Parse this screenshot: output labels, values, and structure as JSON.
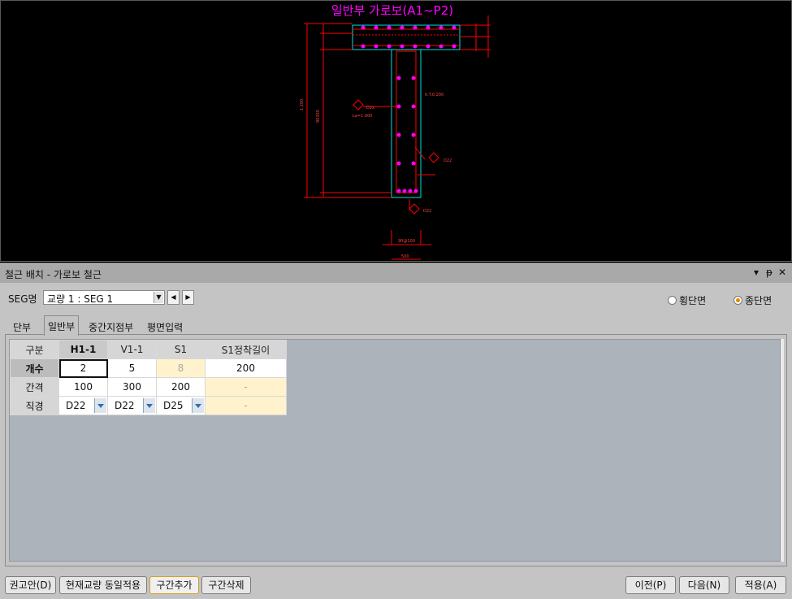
{
  "drawing": {
    "title": "일반부 가로보(A1~P2)",
    "dims": {
      "height_total": "1 200",
      "height_web": "90300",
      "web_note": "0.T.0.200",
      "callout_left": "D2x",
      "callout_left_sub": "La=1.000",
      "callout_right": "D22",
      "callout_bottom": "D22",
      "bottom_dim": "90@100",
      "bottom_total": "500"
    },
    "colors": {
      "background": "#000000",
      "dim": "#ff0000",
      "section": "#00e0e0",
      "rebar": "#ff00ff",
      "title": "#ff00ff"
    }
  },
  "panel": {
    "title": "철근 배치 - 가로보 철근",
    "controls": [
      "▾",
      "ᵽ",
      "✕"
    ]
  },
  "seg": {
    "label": "SEG명",
    "value": "교량 1 : SEG 1"
  },
  "radios": [
    {
      "label": "횡단면",
      "checked": false
    },
    {
      "label": "종단면",
      "checked": true
    }
  ],
  "tabs": [
    "단부",
    "일반부",
    "중간지점부",
    "평면입력"
  ],
  "active_tab": "일반부",
  "table": {
    "corner": "구분",
    "columns": [
      "H1-1",
      "V1-1",
      "S1",
      "S1정착길이"
    ],
    "rows": [
      {
        "label": "개수",
        "cells": [
          "2",
          "5",
          "8",
          "200"
        ]
      },
      {
        "label": "간격",
        "cells": [
          "100",
          "300",
          "200",
          "-"
        ]
      },
      {
        "label": "직경",
        "cells": [
          "D22",
          "D22",
          "D25",
          "-"
        ]
      }
    ]
  },
  "buttons": {
    "recommend": "권고안(D)",
    "apply_same": "현재교량 동일적용",
    "add_section": "구간추가",
    "delete_section": "구간삭제",
    "prev": "이전(P)",
    "next": "다음(N)",
    "apply": "적용(A)"
  }
}
